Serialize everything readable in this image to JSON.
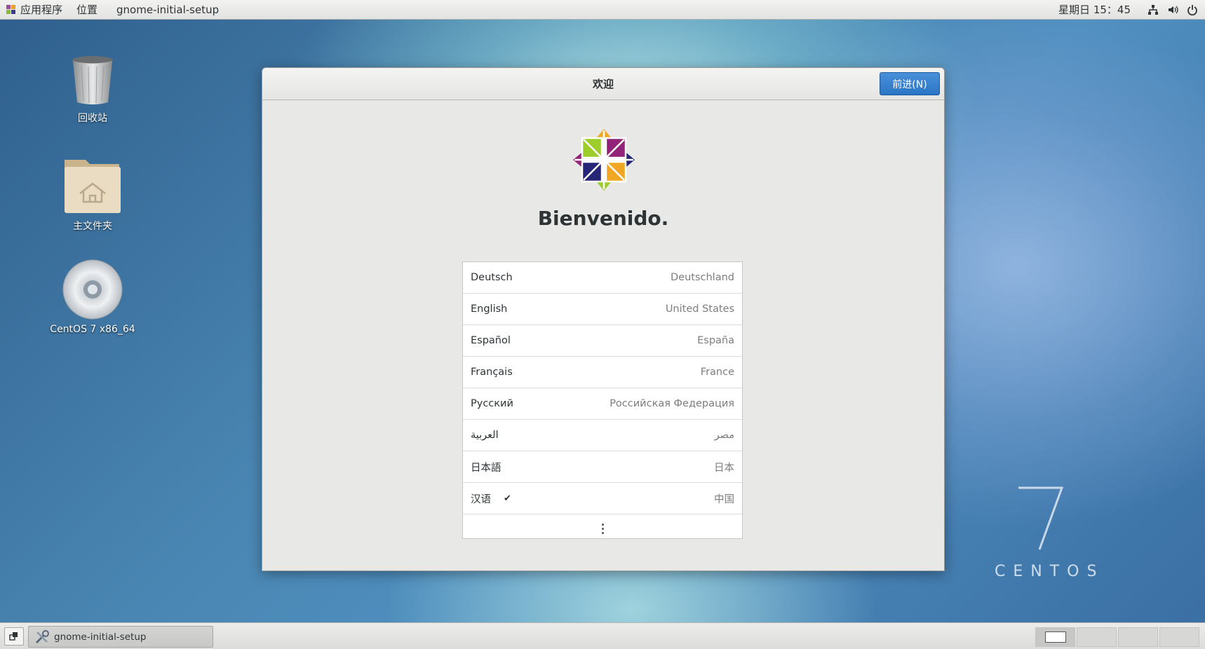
{
  "top_panel": {
    "applications_label": "应用程序",
    "places_label": "位置",
    "active_app_label": "gnome-initial-setup",
    "clock": "星期日 15：45",
    "icons": [
      "network-icon",
      "volume-icon",
      "power-icon"
    ]
  },
  "desktop": {
    "icons": [
      {
        "label": "回收站",
        "icon": "trash-icon"
      },
      {
        "label": "主文件夹",
        "icon": "home-folder-icon"
      },
      {
        "label": "CentOS 7 x86_64",
        "icon": "optical-disc-icon"
      }
    ],
    "watermark": {
      "number": "7",
      "text": "CENTOS"
    }
  },
  "window": {
    "title": "欢迎",
    "next_button_label": "前进(N)",
    "welcome_text": "Bienvenido.",
    "languages": [
      {
        "name": "Deutsch",
        "country": "Deutschland",
        "selected": false
      },
      {
        "name": "English",
        "country": "United States",
        "selected": false
      },
      {
        "name": "Español",
        "country": "España",
        "selected": false
      },
      {
        "name": "Français",
        "country": "France",
        "selected": false
      },
      {
        "name": "Русский",
        "country": "Российская Федерация",
        "selected": false
      },
      {
        "name": "العربية",
        "country": "مصر",
        "selected": false
      },
      {
        "name": "日本語",
        "country": "日本",
        "selected": false
      },
      {
        "name": "汉语",
        "country": "中国",
        "selected": true
      }
    ],
    "check_mark": "✔"
  },
  "bottom_panel": {
    "task_label": "gnome-initial-setup",
    "workspace_count": 4,
    "active_workspace": 1
  },
  "colors": {
    "accent": "#2a76c6",
    "panel_bg": "#e8e8e7"
  }
}
